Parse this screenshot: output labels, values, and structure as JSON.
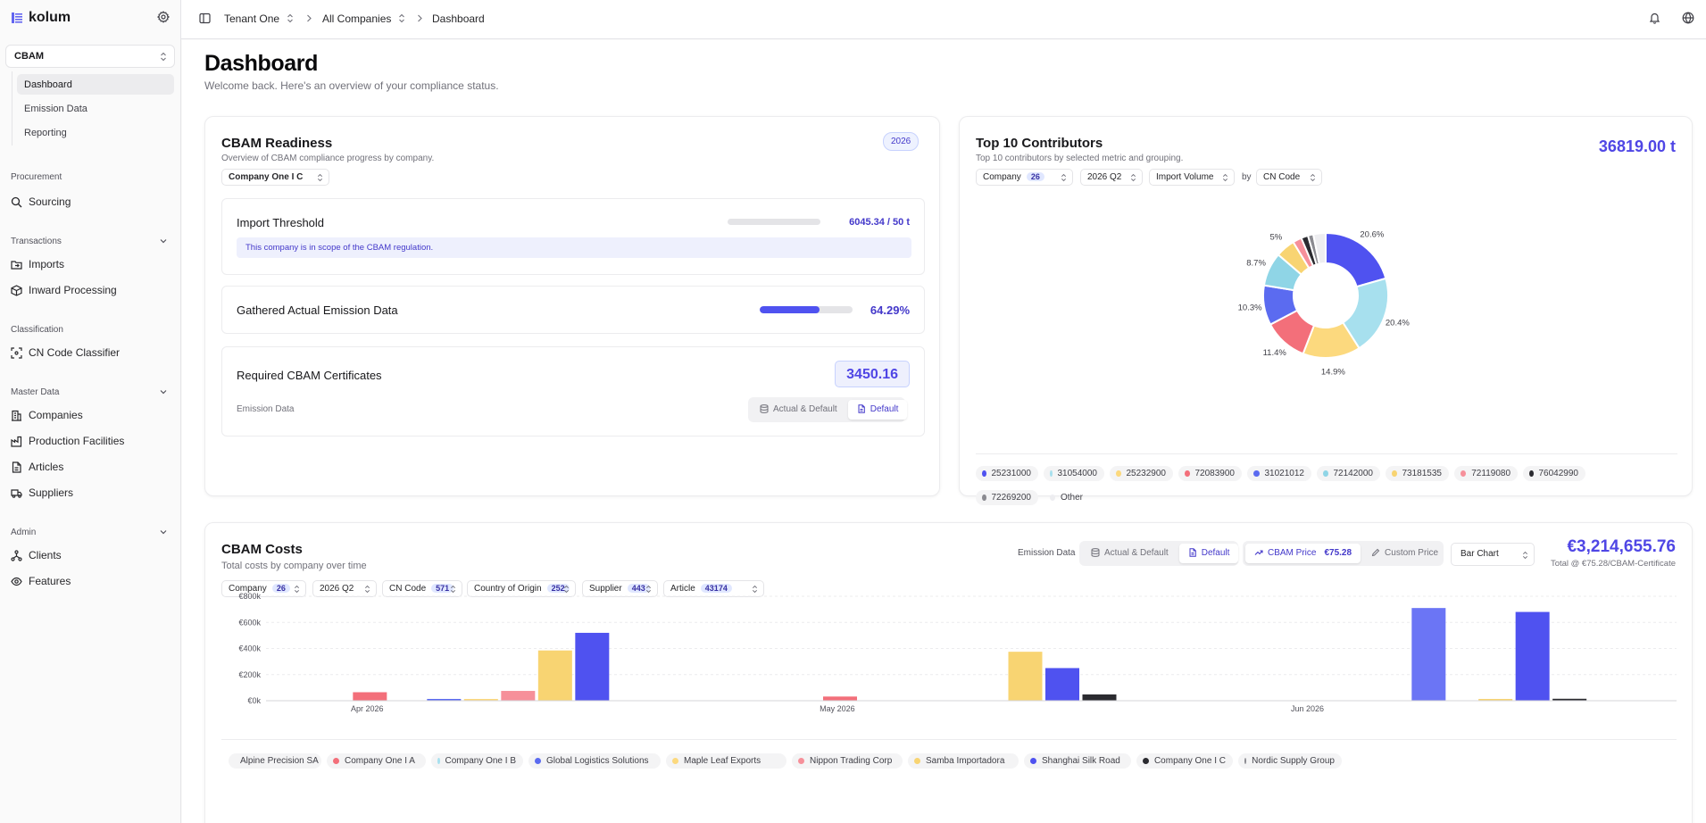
{
  "sidebar": {
    "logo": "kolum",
    "module": "CBAM",
    "sub_items": [
      {
        "label": "Dashboard",
        "active": true
      },
      {
        "label": "Emission Data",
        "active": false
      },
      {
        "label": "Reporting",
        "active": false
      }
    ],
    "sections": [
      {
        "label": "Procurement",
        "items": [
          {
            "label": "Sourcing",
            "icon": "search-icon"
          }
        ]
      },
      {
        "label": "Transactions",
        "items": [
          {
            "label": "Imports",
            "icon": "folder-import-icon"
          },
          {
            "label": "Inward Processing",
            "icon": "package-icon"
          }
        ]
      },
      {
        "label": "Classification",
        "items": [
          {
            "label": "CN Code Classifier",
            "icon": "scan-icon"
          }
        ]
      },
      {
        "label": "Master Data",
        "items": [
          {
            "label": "Companies",
            "icon": "building-icon"
          },
          {
            "label": "Production Facilities",
            "icon": "factory-icon"
          },
          {
            "label": "Articles",
            "icon": "document-icon"
          },
          {
            "label": "Suppliers",
            "icon": "truck-icon"
          }
        ]
      },
      {
        "label": "Admin",
        "items": [
          {
            "label": "Clients",
            "icon": "network-icon"
          },
          {
            "label": "Features",
            "icon": "eye-icon"
          }
        ]
      }
    ]
  },
  "topbar": {
    "tenant": "Tenant One",
    "companies": "All Companies",
    "page": "Dashboard"
  },
  "header": {
    "title": "Dashboard",
    "subtitle": "Welcome back. Here's an overview of your compliance status."
  },
  "readiness": {
    "title": "CBAM Readiness",
    "subtitle": "Overview of CBAM compliance progress by company.",
    "year_badge": "2026",
    "company_select": "Company One I C",
    "threshold": {
      "label": "Import Threshold",
      "value": "6045.34 / 50 t",
      "progress": 1.0,
      "notice": "This company is in scope of the CBAM regulation."
    },
    "gathered": {
      "label": "Gathered Actual Emission Data",
      "value": "64.29%",
      "progress": 0.6429
    },
    "certificates": {
      "label": "Required CBAM Certificates",
      "value": "3450.16",
      "emission_label": "Emission Data",
      "opt_actual": "Actual & Default",
      "opt_default": "Default"
    }
  },
  "contributors": {
    "title": "Top 10 Contributors",
    "subtitle": "Top 10 contributors by selected metric and grouping.",
    "total": "36819.00 t",
    "filters": {
      "company": "Company",
      "company_count": "26",
      "period": "2026 Q2",
      "metric": "Import Volume",
      "by": "by",
      "group": "CN Code"
    },
    "legend": [
      {
        "label": "25231000",
        "color": "#4f52f0"
      },
      {
        "label": "31054000",
        "color": "#a7e0ee"
      },
      {
        "label": "25232900",
        "color": "#fcd97e"
      },
      {
        "label": "72083900",
        "color": "#f36f7a"
      },
      {
        "label": "31021012",
        "color": "#5b6bf0"
      },
      {
        "label": "72142000",
        "color": "#8fd5e6"
      },
      {
        "label": "73181535",
        "color": "#f8d472"
      },
      {
        "label": "72119080",
        "color": "#f6909a"
      },
      {
        "label": "76042990",
        "color": "#2b2b30"
      },
      {
        "label": "72269200",
        "color": "#8a8a90"
      },
      {
        "label": "Other",
        "color": "#ededf0"
      }
    ]
  },
  "chart_data": {
    "type": "pie",
    "title": "Top 10 Contributors",
    "labels": [
      "25231000",
      "31054000",
      "25232900",
      "72083900",
      "31021012",
      "72142000",
      "73181535",
      "72119080",
      "76042990",
      "72269200",
      "Other"
    ],
    "values": [
      20.6,
      20.4,
      14.9,
      11.4,
      10.3,
      8.7,
      5.0,
      2.3,
      1.8,
      1.4,
      3.2
    ],
    "data_labels": [
      "20.6%",
      "20.4%",
      "14.9%",
      "11.4%",
      "10.3%",
      "8.7%",
      "5%",
      "",
      "",
      "",
      ""
    ],
    "colors": [
      "#4f52f0",
      "#a7e0ee",
      "#fcd97e",
      "#f36f7a",
      "#5b6bf0",
      "#8fd5e6",
      "#f8d472",
      "#f6909a",
      "#2b2b30",
      "#8a8a90",
      "#ededf0"
    ],
    "donut": true
  },
  "costs": {
    "title": "CBAM Costs",
    "subtitle": "Total costs by company over time",
    "emission_label": "Emission Data",
    "opt_actual": "Actual & Default",
    "opt_default": "Default",
    "price_label": "CBAM Price",
    "price_value": "€75.28",
    "custom_price": "Custom Price",
    "chart_type": "Bar Chart",
    "total": "€3,214,655.76",
    "total_sub": "Total @ €75.28/CBAM-Certificate",
    "filters": [
      {
        "label": "Company",
        "count": "26"
      },
      {
        "label": "2026 Q2",
        "count": ""
      },
      {
        "label": "CN Code",
        "count": "571"
      },
      {
        "label": "Country of Origin",
        "count": "252"
      },
      {
        "label": "Supplier",
        "count": "443"
      },
      {
        "label": "Article",
        "count": "43174"
      }
    ],
    "chart": {
      "type": "bar",
      "categories": [
        "Apr 2026",
        "May 2026",
        "Jun 2026"
      ],
      "ylim": [
        0,
        800000
      ],
      "y_ticks": [
        "€0k",
        "€200k",
        "€400k",
        "€600k",
        "€800k"
      ],
      "series": [
        {
          "name": "Alpine Precision SA",
          "color": "#8fd5e6",
          "values": [
            0,
            0,
            0
          ]
        },
        {
          "name": "Company One I A",
          "color": "#f36f7a",
          "values": [
            65000,
            32000,
            0
          ]
        },
        {
          "name": "Company One I B",
          "color": "#a7e0ee",
          "values": [
            0,
            0,
            0
          ]
        },
        {
          "name": "Global Logistics Solutions",
          "color": "#5b6bf0",
          "values": [
            12000,
            0,
            0
          ]
        },
        {
          "name": "Maple Leaf Exports",
          "color": "#fcd97e",
          "values": [
            8000,
            0,
            0
          ]
        },
        {
          "name": "Nippon Trading Corp",
          "color": "#f6909a",
          "values": [
            75000,
            0,
            0
          ]
        },
        {
          "name": "Samba Importadora",
          "color": "#f8d472",
          "values": [
            385000,
            375000,
            5000
          ]
        },
        {
          "name": "Shanghai Silk Road",
          "color": "#4f52f0",
          "values": [
            520000,
            250000,
            680000
          ]
        },
        {
          "name": "Company One I C",
          "color": "#2b2b30",
          "values": [
            0,
            48000,
            15000
          ]
        },
        {
          "name": "Nordic Supply Group",
          "color": "#8a8a90",
          "values": [
            0,
            0,
            0
          ]
        }
      ],
      "extra_bar": {
        "category": "Jun 2026",
        "value": 710000,
        "color": "#6b75f5"
      }
    }
  }
}
